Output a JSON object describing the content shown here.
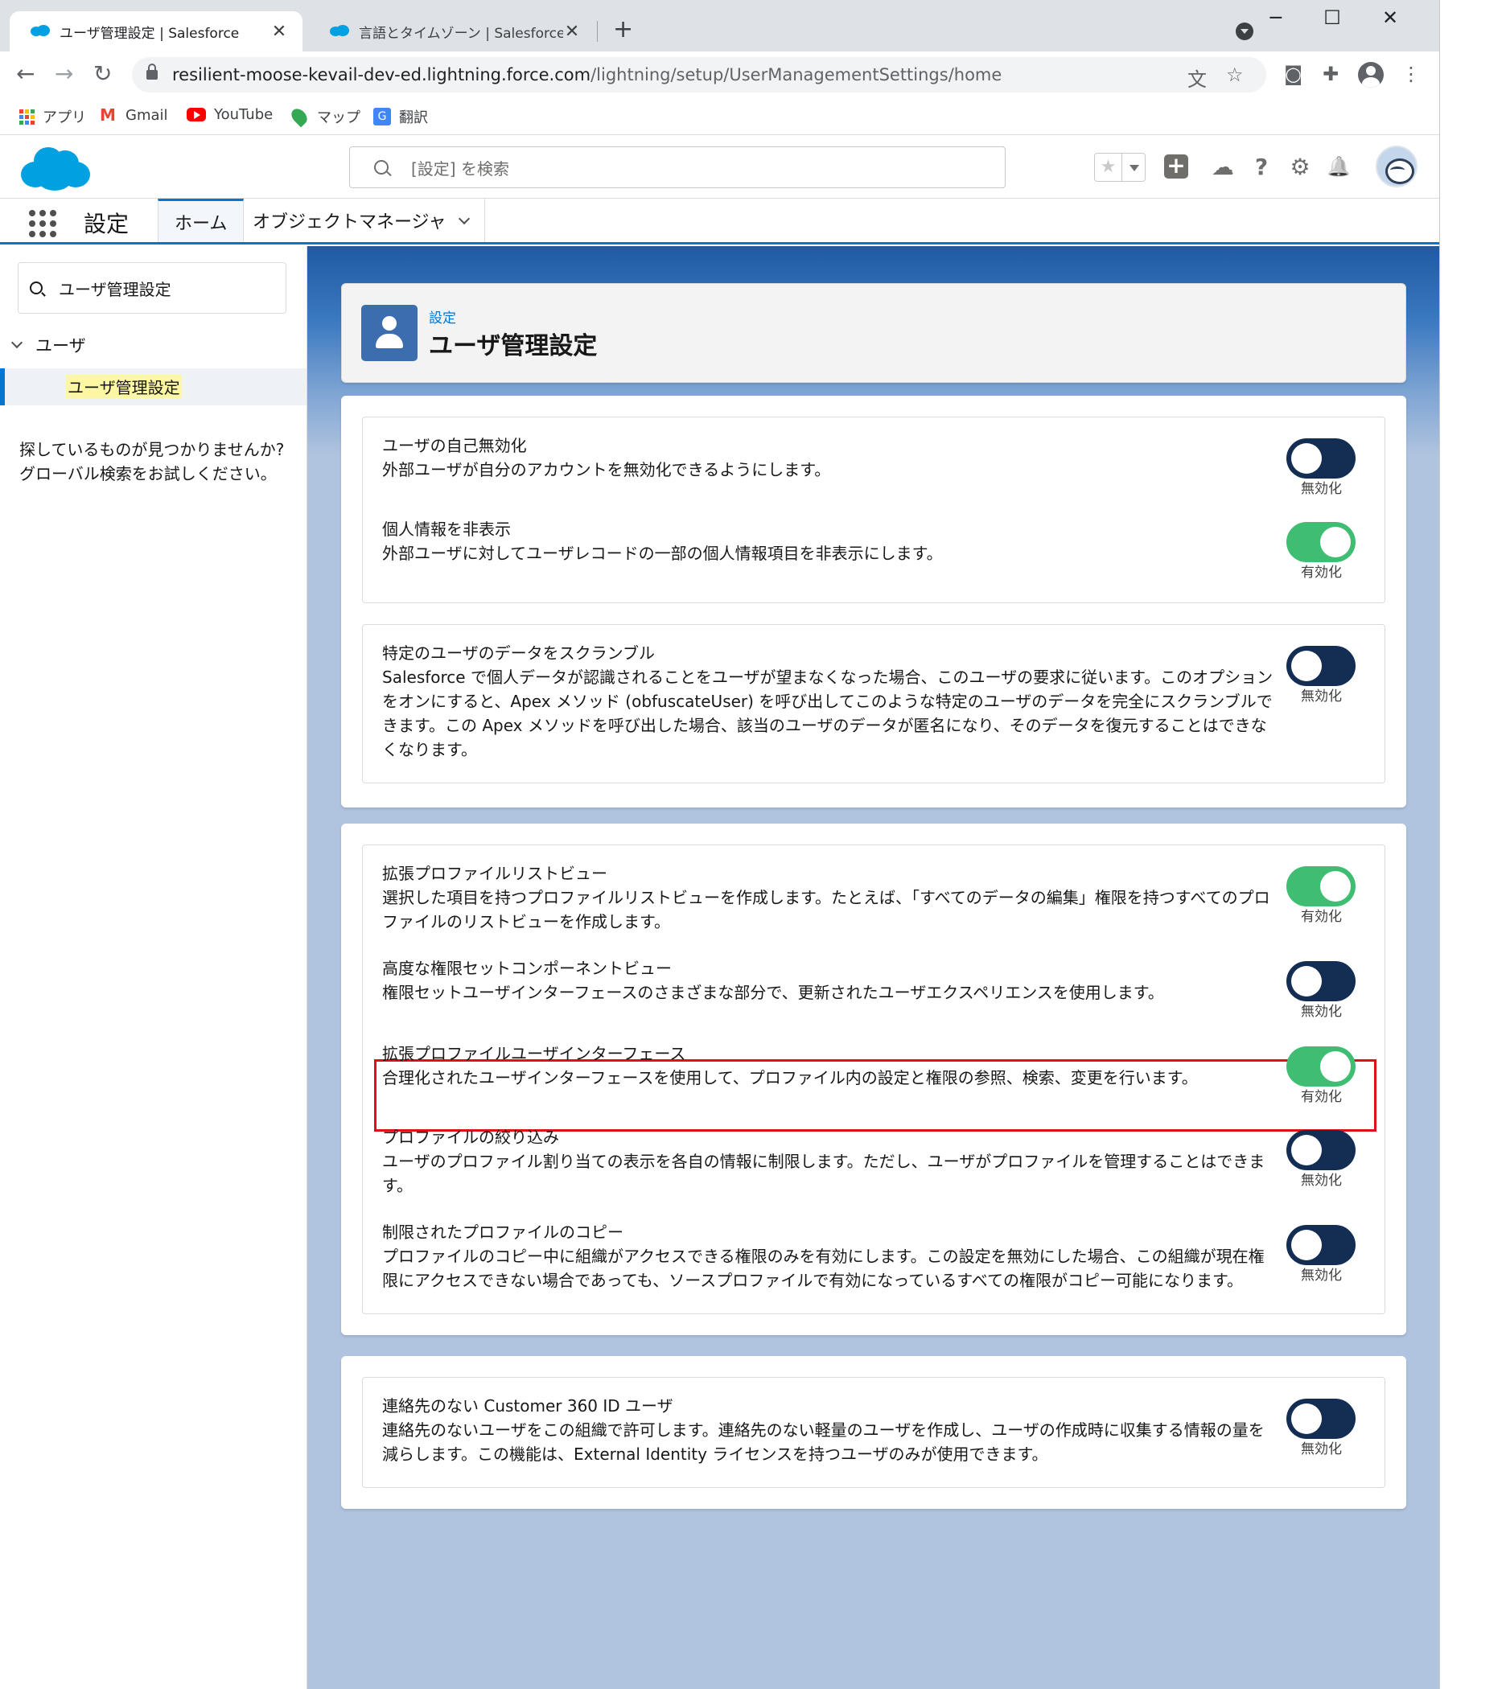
{
  "browser": {
    "tabs": [
      {
        "title": "ユーザ管理設定 | Salesforce",
        "close": "✕"
      },
      {
        "title": "言語とタイムゾーン | Salesforce",
        "close": "✕"
      }
    ],
    "new_tab": "+",
    "window_controls": {
      "minimize": "─",
      "maximize": "☐",
      "close": "✕"
    },
    "nav": {
      "back": "←",
      "forward": "→",
      "reload": "↻"
    },
    "url_host": "resilient-moose-kevail-dev-ed.lightning.force.com",
    "url_path": "/lightning/setup/UserManagementSettings/home",
    "icons": {
      "translate": "文",
      "star": "☆",
      "camera": "◙",
      "extensions": "✚",
      "menu": "⋮"
    },
    "bookmarks": [
      {
        "label": "アプリ",
        "icon": "apps-icon"
      },
      {
        "label": "Gmail",
        "icon": "gmail-icon"
      },
      {
        "label": "YouTube",
        "icon": "youtube-icon"
      },
      {
        "label": "マップ",
        "icon": "maps-icon"
      },
      {
        "label": "翻訳",
        "icon": "translate-icon"
      }
    ]
  },
  "sf_header": {
    "search_placeholder": "[設定] を検索",
    "fav_star": "★",
    "help": "?",
    "gear": "⚙",
    "bell": "🔔",
    "cloud": "☁"
  },
  "sf_nav": {
    "app_name": "設定",
    "tabs": [
      {
        "label": "ホーム"
      },
      {
        "label": "オブジェクトマネージャ"
      }
    ]
  },
  "sidebar": {
    "quickfind_value": "ユーザ管理設定",
    "tree_node": "ユーザ",
    "tree_leaf": "ユーザ管理設定",
    "help_text": "探しているものが見つかりませんか? グローバル検索をお試しください。"
  },
  "page": {
    "breadcrumb": "設定",
    "title": "ユーザ管理設定"
  },
  "settings": {
    "card1_a": [
      {
        "title": "ユーザの自己無効化",
        "desc": "外部ユーザが自分のアカウントを無効化できるようにします。",
        "state": "無効化",
        "on": false
      },
      {
        "title": "個人情報を非表示",
        "desc": "外部ユーザに対してユーザレコードの一部の個人情報項目を非表示にします。",
        "state": "有効化",
        "on": true
      }
    ],
    "card1_b": [
      {
        "title": "特定のユーザのデータをスクランブル",
        "desc": "Salesforce で個人データが認識されることをユーザが望まなくなった場合、このユーザの要求に従います。このオプションをオンにすると、Apex メソッド (obfuscateUser) を呼び出してこのような特定のユーザのデータを完全にスクランブルできます。この Apex メソッドを呼び出した場合、該当のユーザのデータが匿名になり、そのデータを復元することはできなくなります。",
        "state": "無効化",
        "on": false
      }
    ],
    "card2": [
      {
        "title": "拡張プロファイルリストビュー",
        "desc": "選択した項目を持つプロファイルリストビューを作成します。たとえば、「すべてのデータの編集」権限を持つすべてのプロファイルのリストビューを作成します。",
        "state": "有効化",
        "on": true
      },
      {
        "title": "高度な権限セットコンポーネントビュー",
        "desc": "権限セットユーザインターフェースのさまざまな部分で、更新されたユーザエクスペリエンスを使用します。",
        "state": "無効化",
        "on": false
      },
      {
        "title": "拡張プロファイルユーザインターフェース",
        "desc": "合理化されたユーザインターフェースを使用して、プロファイル内の設定と権限の参照、検索、変更を行います。",
        "state": "有効化",
        "on": true
      },
      {
        "title": "プロファイルの絞り込み",
        "desc": "ユーザのプロファイル割り当ての表示を各自の情報に制限します。ただし、ユーザがプロファイルを管理することはできます。",
        "state": "無効化",
        "on": false
      },
      {
        "title": "制限されたプロファイルのコピー",
        "desc": "プロファイルのコピー中に組織がアクセスできる権限のみを有効にします。この設定を無効にした場合、この組織が現在権限にアクセスできない場合であっても、ソースプロファイルで有効になっているすべての権限がコピー可能になります。",
        "state": "無効化",
        "on": false
      }
    ],
    "card3": [
      {
        "title": "連絡先のない Customer 360 ID ユーザ",
        "desc": "連絡先のないユーザをこの組織で許可します。連絡先のない軽量のユーザを作成し、ユーザの作成時に収集する情報の量を減らします。この機能は、External Identity ライセンスを持つユーザのみが使用できます。",
        "state": "無効化",
        "on": false
      }
    ]
  },
  "colors": {
    "toggle_on": "#3fbd73",
    "toggle_off": "#132e52",
    "brand": "#0176d3",
    "highlight": "#e0101b"
  }
}
